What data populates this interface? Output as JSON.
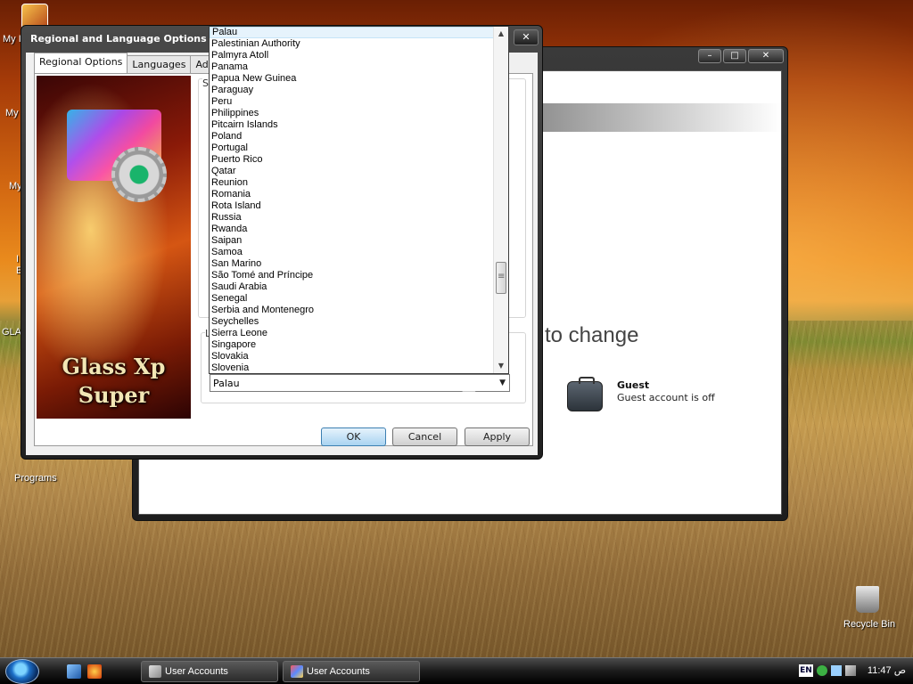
{
  "desktop": {
    "icons": [
      {
        "label": "My I"
      },
      {
        "label": "My"
      },
      {
        "label": "My"
      },
      {
        "label": "I"
      },
      {
        "label": "E"
      },
      {
        "label": "GLA"
      },
      {
        "label": "Programs"
      },
      {
        "label": "Recycle Bin"
      }
    ]
  },
  "back_window": {
    "heading_fragment": "to change",
    "account": {
      "name": "Guest",
      "status": "Guest account is off"
    },
    "caption_buttons": [
      "–",
      "□",
      "✕"
    ]
  },
  "dialog": {
    "title": "Regional and Language Options",
    "close_glyph": "✕",
    "tabs": [
      "Regional Options",
      "Languages",
      "Advanced"
    ],
    "active_tab": 0,
    "brand_line1": "Glass Xp",
    "brand_line2": "Super",
    "section_letter_s": "S",
    "section_letter_l": "L",
    "location_selected": "Palau",
    "buttons": {
      "ok": "OK",
      "cancel": "Cancel",
      "apply": "Apply"
    }
  },
  "dropdown": {
    "selected": "Palau",
    "items": [
      "Palau",
      "Palestinian Authority",
      "Palmyra Atoll",
      "Panama",
      "Papua New Guinea",
      "Paraguay",
      "Peru",
      "Philippines",
      "Pitcairn Islands",
      "Poland",
      "Portugal",
      "Puerto Rico",
      "Qatar",
      "Reunion",
      "Romania",
      "Rota Island",
      "Russia",
      "Rwanda",
      "Saipan",
      "Samoa",
      "San Marino",
      "São Tomé and Príncipe",
      "Saudi Arabia",
      "Senegal",
      "Serbia and Montenegro",
      "Seychelles",
      "Sierra Leone",
      "Singapore",
      "Slovakia",
      "Slovenia"
    ]
  },
  "taskbar": {
    "tasks": [
      {
        "label": "User Accounts"
      },
      {
        "label": "User Accounts"
      }
    ],
    "language": "EN",
    "clock": "11:47 ص"
  }
}
